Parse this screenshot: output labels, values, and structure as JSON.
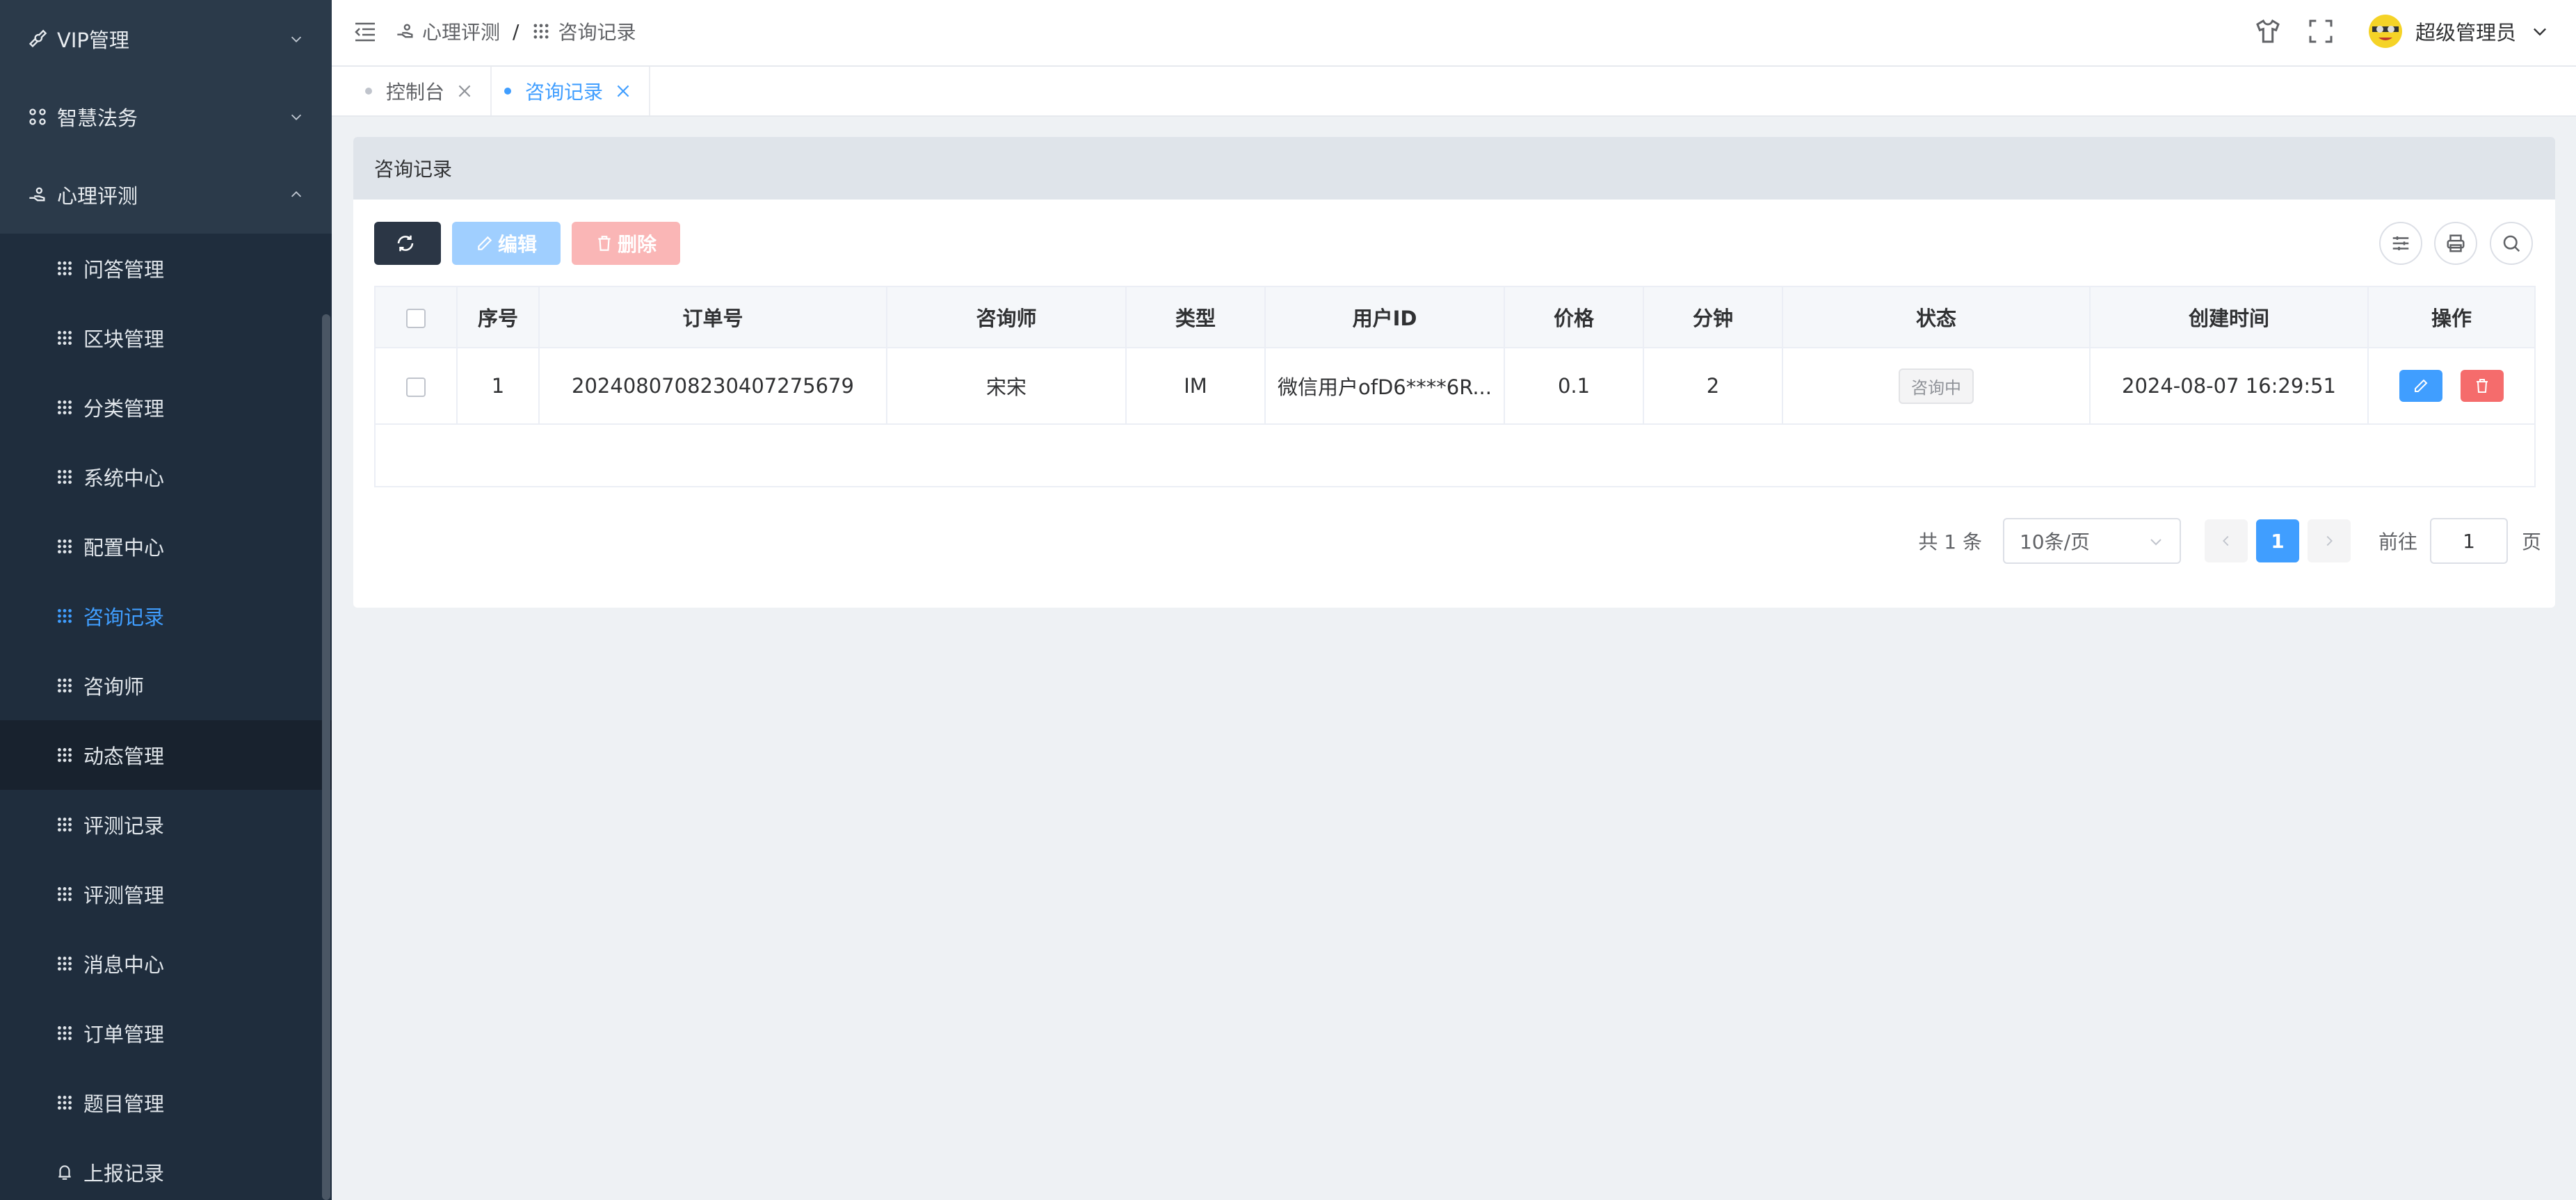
{
  "sidebar": {
    "top_items": [
      {
        "label": "VIP管理",
        "icon": "wrench-icon"
      },
      {
        "label": "智慧法务",
        "icon": "apps-icon"
      },
      {
        "label": "心理评测",
        "icon": "cloud-hand-icon"
      }
    ],
    "sub_items": [
      {
        "label": "问答管理"
      },
      {
        "label": "区块管理"
      },
      {
        "label": "分类管理"
      },
      {
        "label": "系统中心"
      },
      {
        "label": "配置中心"
      },
      {
        "label": "咨询记录"
      },
      {
        "label": "咨询师"
      },
      {
        "label": "动态管理"
      },
      {
        "label": "评测记录"
      },
      {
        "label": "评测管理"
      },
      {
        "label": "消息中心"
      },
      {
        "label": "订单管理"
      },
      {
        "label": "题目管理"
      },
      {
        "label": "上报记录"
      }
    ],
    "active_item": "咨询记录",
    "accent_color": "#409eff"
  },
  "header": {
    "breadcrumb": [
      "心理评测",
      "咨询记录"
    ],
    "breadcrumb_sep": "/",
    "user_name": "超级管理员"
  },
  "tabs": [
    {
      "label": "控制台",
      "active": false
    },
    {
      "label": "咨询记录",
      "active": true
    }
  ],
  "card": {
    "title": "咨询记录",
    "buttons": {
      "edit": "编辑",
      "delete": "删除"
    }
  },
  "table": {
    "columns": [
      "序号",
      "订单号",
      "咨询师",
      "类型",
      "用户ID",
      "价格",
      "分钟",
      "状态",
      "创建时间",
      "操作"
    ],
    "rows": [
      {
        "index": "1",
        "order_no": "2024080708230407275679",
        "counselor": "宋宋",
        "type": "IM",
        "user_id": "微信用户ofD6****6R...",
        "price": "0.1",
        "minutes": "2",
        "status": "咨询中",
        "created_at": "2024-08-07 16:29:51"
      }
    ]
  },
  "pagination": {
    "total_text": "共 1 条",
    "page_size": "10条/页",
    "current_page": "1",
    "goto_label": "前往",
    "goto_value": "1",
    "goto_suffix": "页"
  }
}
